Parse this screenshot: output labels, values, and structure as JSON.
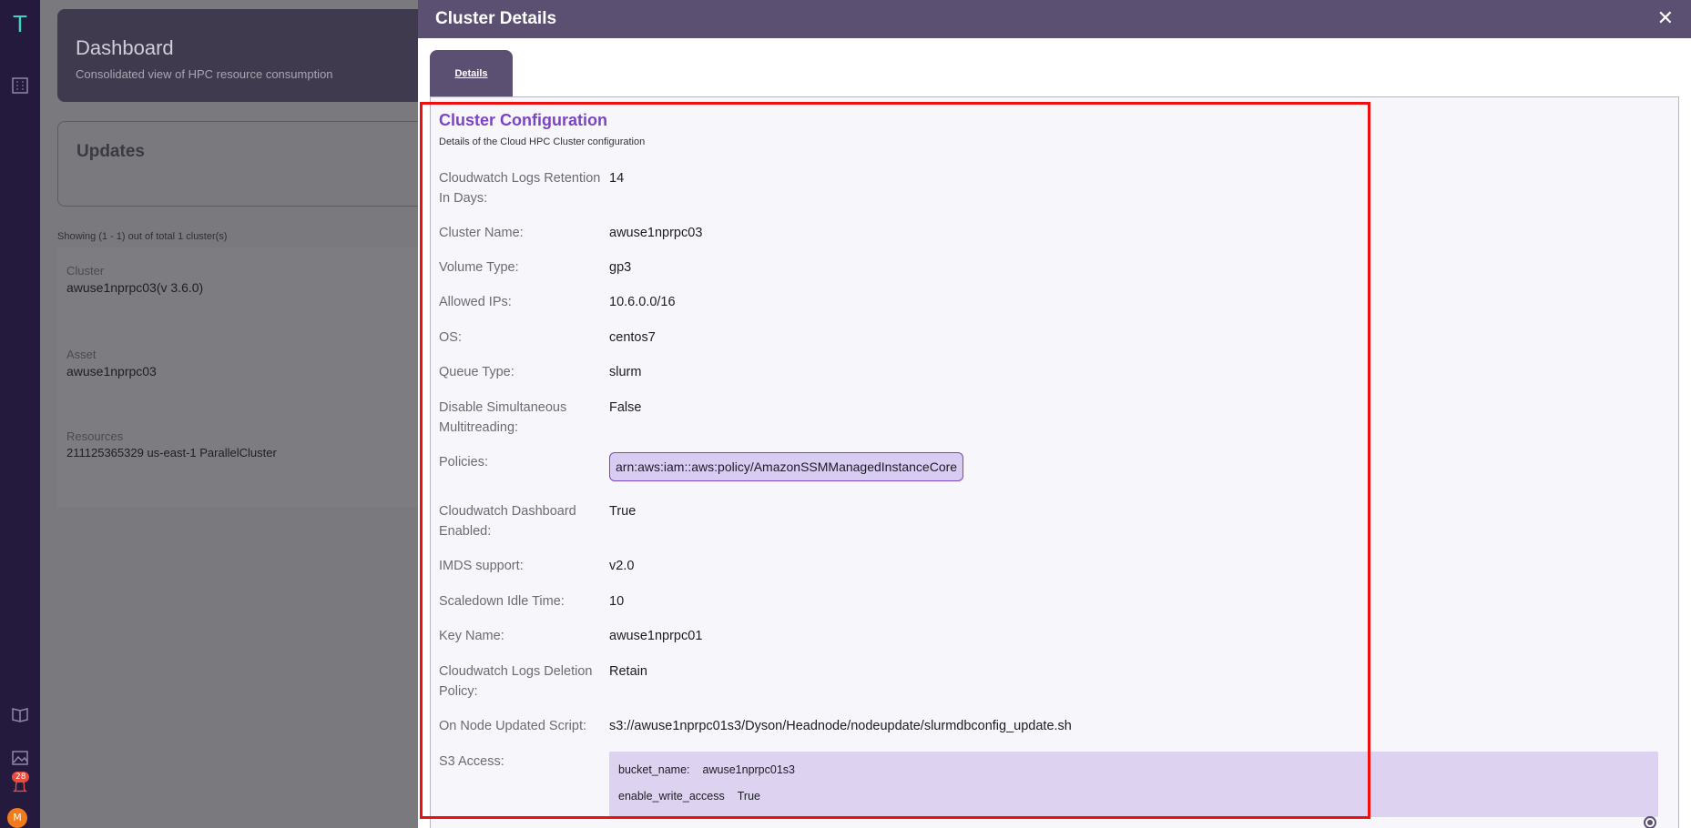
{
  "rail": {
    "logo": "T",
    "notification_count": "28",
    "avatar_initial": "M"
  },
  "background": {
    "dashboard_title": "Dashboard",
    "dashboard_subtitle": "Consolidated view of HPC resource consumption",
    "updates_title": "Updates",
    "showing": "Showing (1 - 1) out of total 1 cluster(s)",
    "cluster_label": "Cluster",
    "cluster_value": "awuse1nprpc03(v 3.6.0)",
    "asset_label": "Asset",
    "asset_value": "awuse1nprpc03",
    "resources_label": "Resources",
    "resources_value": "211125365329 us-east-1 ParallelCluster"
  },
  "drawer": {
    "title": "Cluster Details",
    "close": "✕",
    "tab_label": "Details",
    "section_title": "Cluster Configuration",
    "section_subtitle": "Details of the Cloud HPC Cluster configuration",
    "fields": {
      "cloudwatch_retention_label": "Cloudwatch Logs Retention In Days:",
      "cloudwatch_retention_value": "14",
      "cluster_name_label": "Cluster Name:",
      "cluster_name_value": "awuse1nprpc03",
      "volume_type_label": "Volume Type:",
      "volume_type_value": "gp3",
      "allowed_ips_label": "Allowed IPs:",
      "allowed_ips_value": "10.6.0.0/16",
      "os_label": "OS:",
      "os_value": "centos7",
      "queue_type_label": "Queue Type:",
      "queue_type_value": "slurm",
      "disable_smt_label": "Disable Simultaneous Multitreading:",
      "disable_smt_value": "False",
      "policies_label": "Policies:",
      "policies_value": "arn:aws:iam::aws:policy/AmazonSSMManagedInstanceCore",
      "cw_dashboard_label": "Cloudwatch Dashboard Enabled:",
      "cw_dashboard_value": "True",
      "imds_label": "IMDS support:",
      "imds_value": "v2.0",
      "scaledown_label": "Scaledown Idle Time:",
      "scaledown_value": "10",
      "key_name_label": "Key Name:",
      "key_name_value": "awuse1nprpc01",
      "cw_deletion_label": "Cloudwatch Logs Deletion Policy:",
      "cw_deletion_value": "Retain",
      "on_node_label": "On Node Updated Script:",
      "on_node_value": "s3://awuse1nprpc01s3/Dyson/Headnode/nodeupdate/slurmdbconfig_update.sh",
      "s3_label": "S3 Access:",
      "s3_bucket_key": "bucket_name:",
      "s3_bucket_value": "awuse1nprpc01s3",
      "s3_write_key": "enable_write_access",
      "s3_write_value": "True"
    }
  },
  "colors": {
    "accent": "#7b45c0",
    "header": "#5b4f72",
    "highlight": "#ee0f0f"
  }
}
